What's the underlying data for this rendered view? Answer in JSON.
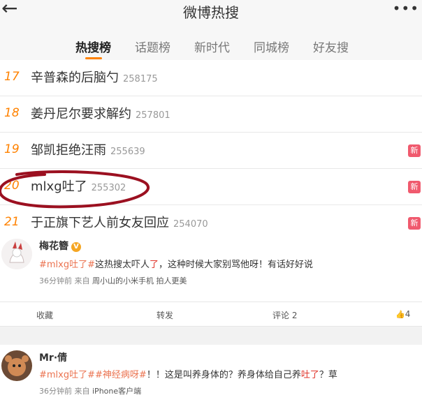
{
  "header": {
    "back_icon": "←",
    "title": "微博热搜",
    "more_icon": "•••"
  },
  "tabs": [
    "热搜榜",
    "话题榜",
    "新时代",
    "同城榜",
    "好友搜"
  ],
  "hot_list": [
    {
      "rank": "17",
      "keyword": "辛普森的后脑勺",
      "count": "258175",
      "new": ""
    },
    {
      "rank": "18",
      "keyword": "姜丹尼尔要求解约",
      "count": "257801",
      "new": ""
    },
    {
      "rank": "19",
      "keyword": "邹凯拒绝汪雨",
      "count": "255639",
      "new": "新"
    },
    {
      "rank": "20",
      "keyword": "mlxg吐了",
      "count": "255302",
      "new": "新"
    },
    {
      "rank": "21",
      "keyword": "于正旗下艺人前女友回应",
      "count": "254070",
      "new": "新"
    }
  ],
  "post1": {
    "username": "梅花簪",
    "verified_icon": "V",
    "topic": "#mlxg吐了#",
    "text_a": "这热搜太吓人",
    "text_hl": "了",
    "text_b": "，这种时候大家别骂他呀！有话好好说",
    "time": "36分钟前",
    "source_prefix": "来自",
    "source": "周小山的小米手机 拍人更美"
  },
  "actions": {
    "repost": "收藏",
    "forward": "转发",
    "comment": "评论 2",
    "like_icon": "👍",
    "like": "4"
  },
  "post2": {
    "username": "Mr·倩",
    "topic1": "#mlxg吐了#",
    "topic2": "#神经病呀#",
    "text_a": "！！这是叫养身体的？养身体给自己养",
    "text_hl": "吐了",
    "text_b": "？草",
    "time": "36分钟前",
    "source_prefix": "来自",
    "source": "iPhone客户端"
  },
  "colors": {
    "accent": "#ff8200",
    "badge": "#f05a6e",
    "annotation": "#9b1020",
    "topic": "#eb7350"
  }
}
